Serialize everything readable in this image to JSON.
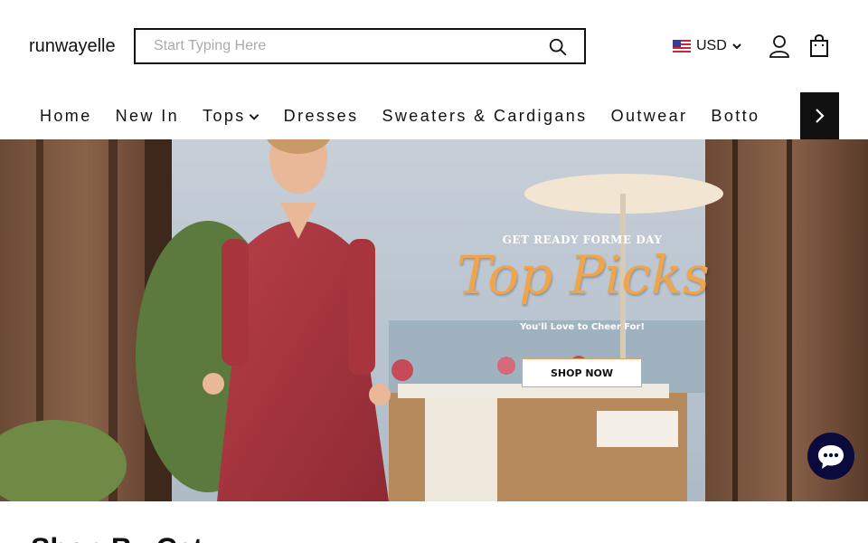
{
  "header": {
    "logo_text": "runwayelle",
    "search_placeholder": "Start Typing Here",
    "currency": "USD",
    "icons": {
      "search": "search-icon",
      "flag": "us-flag-icon",
      "user": "user-icon",
      "bag": "shopping-bag-icon"
    }
  },
  "nav": {
    "items": [
      {
        "label": "Home"
      },
      {
        "label": "New In"
      },
      {
        "label": "Tops"
      },
      {
        "label": "Dresses"
      },
      {
        "label": "Sweaters & Cardigans"
      },
      {
        "label": "Outwear"
      },
      {
        "label": "Botto"
      }
    ]
  },
  "hero": {
    "eyebrow": "GET READY FORME DAY",
    "title": "Top Picks",
    "subtitle": "You'll Love to Cheer For!",
    "cta": "SHOP NOW"
  },
  "section": {
    "title": "Shop By Cat"
  },
  "colors": {
    "accent": "#111111",
    "hero_title": "#f0a54d",
    "chat": "#0a0a3c"
  }
}
